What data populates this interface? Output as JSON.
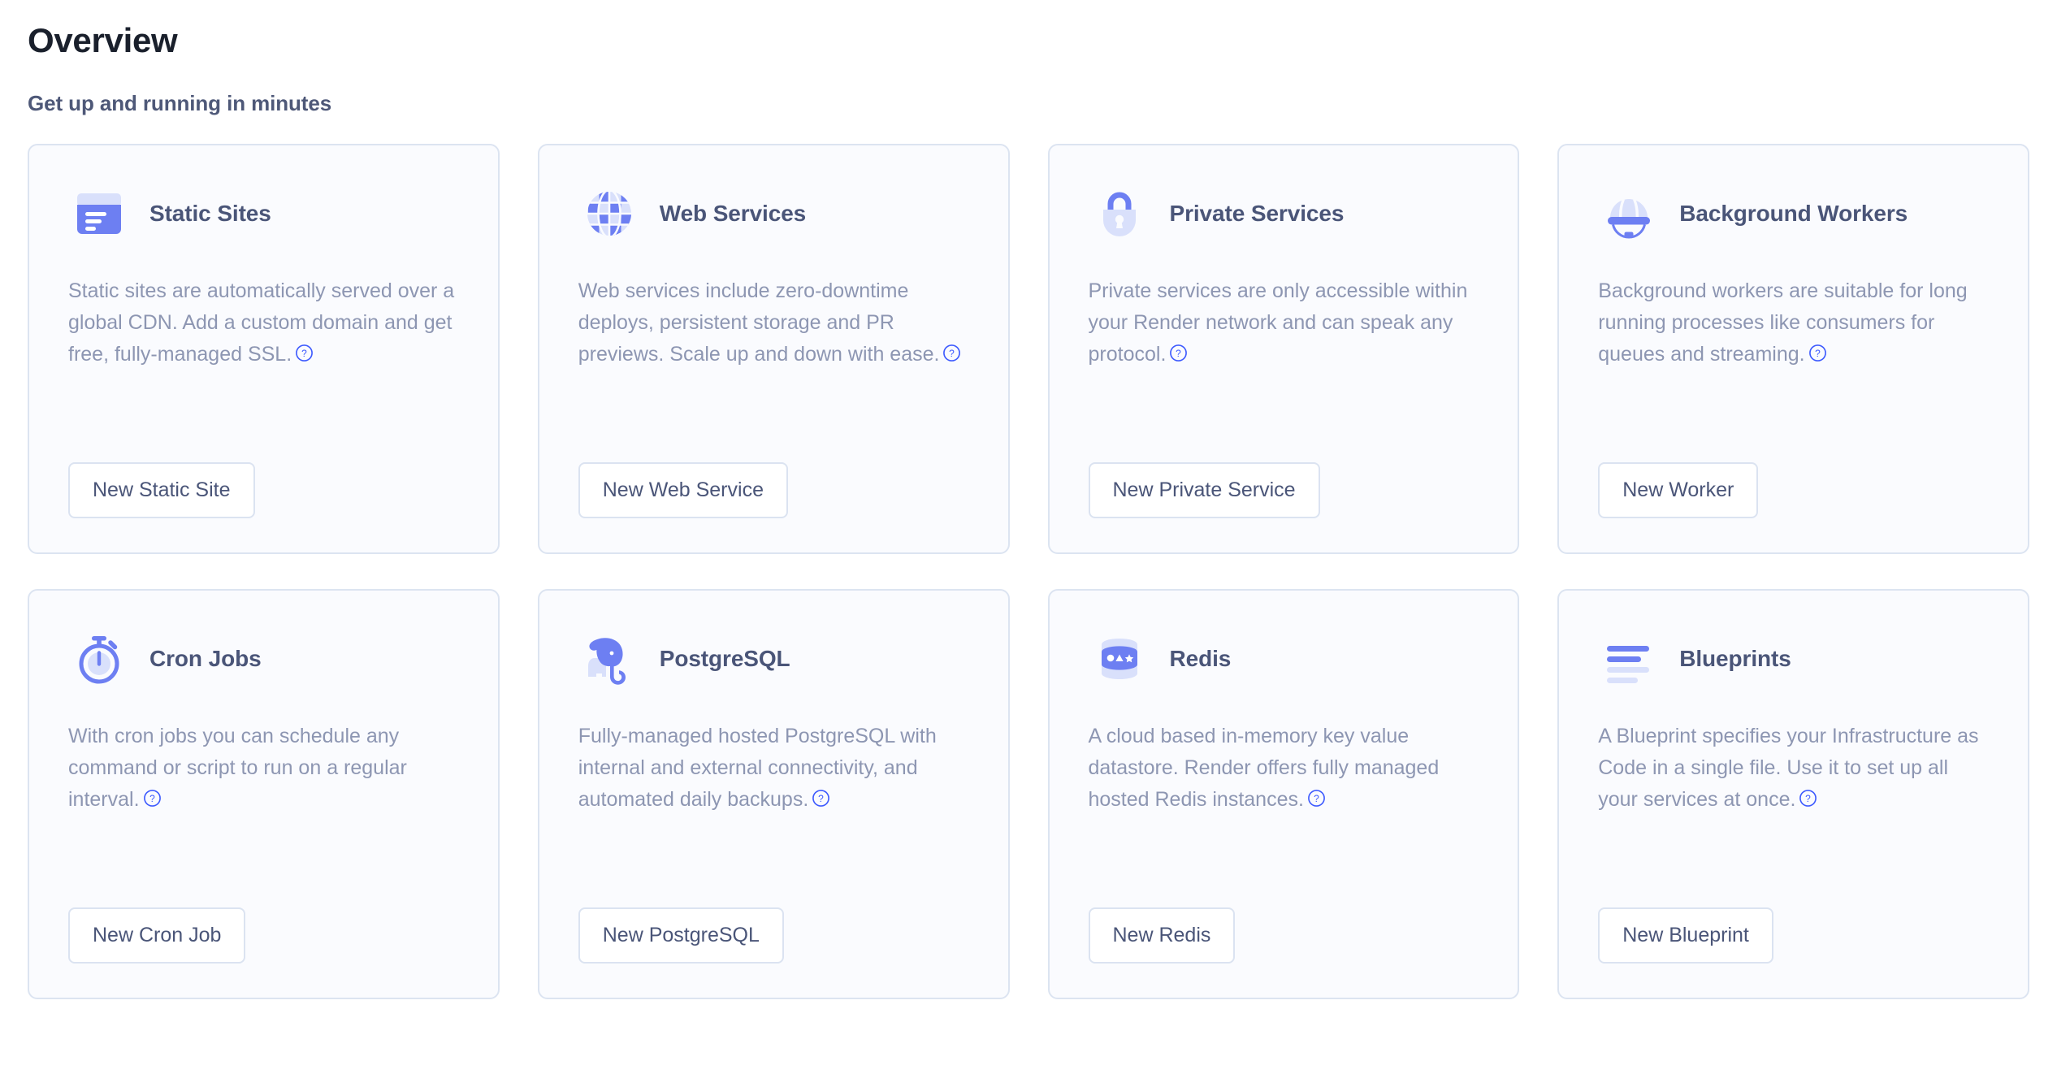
{
  "page": {
    "title": "Overview",
    "section_heading": "Get up and running in minutes"
  },
  "colors": {
    "heading": "#1a202c",
    "section_heading": "#4e5878",
    "card_title": "#4a5578",
    "card_body": "#8d96b2",
    "card_bg": "#fafbfe",
    "card_border": "#dce4f1",
    "icon_primary": "#6d7ff2",
    "icon_secondary": "#d9e0fb",
    "help_icon": "#3d5afe",
    "button_border": "#dbe3f1",
    "button_bg": "#ffffff",
    "page_bg": "#ffffff"
  },
  "cards": [
    {
      "id": "static-sites",
      "icon": "browser-window-icon",
      "title": "Static Sites",
      "description": "Static sites are automatically served over a global CDN. Add a custom domain and get free, fully-managed SSL.",
      "help_icon": "help-circle-icon",
      "button_label": "New Static Site"
    },
    {
      "id": "web-services",
      "icon": "globe-icon",
      "title": "Web Services",
      "description": "Web services include zero-downtime deploys, persistent storage and PR previews. Scale up and down with ease.",
      "help_icon": "help-circle-icon",
      "button_label": "New Web Service"
    },
    {
      "id": "private-services",
      "icon": "padlock-icon",
      "title": "Private Services",
      "description": "Private services are only accessible within your Render network and can speak any protocol.",
      "help_icon": "help-circle-icon",
      "button_label": "New Private Service"
    },
    {
      "id": "background-workers",
      "icon": "hard-hat-icon",
      "title": "Background Workers",
      "description": "Background workers are suitable for long running processes like consumers for queues and streaming.",
      "help_icon": "help-circle-icon",
      "button_label": "New Worker"
    },
    {
      "id": "cron-jobs",
      "icon": "stopwatch-icon",
      "title": "Cron Jobs",
      "description": "With cron jobs you can schedule any command or script to run on a regular interval.",
      "help_icon": "help-circle-icon",
      "button_label": "New Cron Job"
    },
    {
      "id": "postgresql",
      "icon": "elephant-icon",
      "title": "PostgreSQL",
      "description": "Fully-managed hosted PostgreSQL with internal and external connectivity, and automated daily backups.",
      "help_icon": "help-circle-icon",
      "button_label": "New PostgreSQL"
    },
    {
      "id": "redis",
      "icon": "database-cylinder-icon",
      "title": "Redis",
      "description": "A cloud based in-memory key value datastore. Render offers fully managed hosted Redis instances.",
      "help_icon": "help-circle-icon",
      "button_label": "New Redis"
    },
    {
      "id": "blueprints",
      "icon": "stacked-bars-icon",
      "title": "Blueprints",
      "description": "A Blueprint specifies your Infrastructure as Code in a single file. Use it to set up all your services at once.",
      "help_icon": "help-circle-icon",
      "button_label": "New Blueprint"
    }
  ]
}
